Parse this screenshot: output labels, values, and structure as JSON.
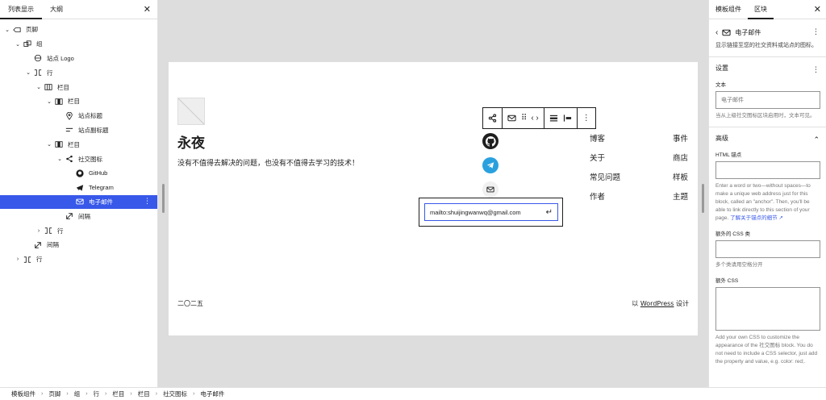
{
  "left_panel": {
    "tabs": [
      "列表显示",
      "大纲"
    ],
    "close_glyph": "✕",
    "tree": [
      {
        "label": "页脚",
        "depth": 0,
        "chev": "⌄",
        "icon": "template-part-icon"
      },
      {
        "label": "组",
        "depth": 1,
        "chev": "⌄",
        "icon": "group-icon"
      },
      {
        "label": "站点 Logo",
        "depth": 2,
        "chev": "",
        "icon": "site-logo-icon"
      },
      {
        "label": "行",
        "depth": 2,
        "chev": "⌄",
        "icon": "row-icon"
      },
      {
        "label": "栏目",
        "depth": 3,
        "chev": "⌄",
        "icon": "columns-icon"
      },
      {
        "label": "栏目",
        "depth": 4,
        "chev": "⌄",
        "icon": "column-icon"
      },
      {
        "label": "站点标题",
        "depth": 5,
        "chev": "",
        "icon": "map-pin-icon"
      },
      {
        "label": "站点副标题",
        "depth": 5,
        "chev": "",
        "icon": "tagline-icon"
      },
      {
        "label": "栏目",
        "depth": 4,
        "chev": "⌄",
        "icon": "column-icon"
      },
      {
        "label": "社交图标",
        "depth": 5,
        "chev": "⌄",
        "icon": "share-icon"
      },
      {
        "label": "GitHub",
        "depth": 6,
        "chev": "",
        "icon": "github-icon"
      },
      {
        "label": "Telegram",
        "depth": 6,
        "chev": "",
        "icon": "telegram-icon"
      },
      {
        "label": "电子邮件",
        "depth": 6,
        "chev": "",
        "icon": "mail-icon",
        "selected": true
      },
      {
        "label": "间隔",
        "depth": 5,
        "chev": "",
        "icon": "spacer-icon"
      },
      {
        "label": "行",
        "depth": 3,
        "chev": "›",
        "icon": "row-icon"
      },
      {
        "label": "间隔",
        "depth": 2,
        "chev": "",
        "icon": "spacer-icon"
      },
      {
        "label": "行",
        "depth": 1,
        "chev": "›",
        "icon": "row-icon"
      }
    ]
  },
  "canvas": {
    "site_title": "永夜",
    "site_tagline": "没有不值得去解决的问题，也没有不值得去学习的技术！",
    "url_value": "mailto:shuijingwanwq@gmail.com",
    "nav_col1": [
      "博客",
      "关于",
      "常见问题",
      "作者"
    ],
    "nav_col2": [
      "事件",
      "商店",
      "样板",
      "主题"
    ],
    "footer_left": "二〇二五",
    "footer_right_prefix": "以 ",
    "footer_right_link": "WordPress",
    "footer_right_suffix": " 设计"
  },
  "right_panel": {
    "tabs": [
      "模板组件",
      "区块"
    ],
    "close_glyph": "✕",
    "block_name": "电子邮件",
    "block_desc": "显示链接至您的社交资料或站点的图标。",
    "settings_title": "设置",
    "text_label": "文本",
    "text_placeholder": "电子邮件",
    "text_help": "当从上级社交图标区块启用时，文本可见。",
    "advanced_title": "高级",
    "anchor_label": "HTML 锚点",
    "anchor_help": "Enter a word or two—without spaces—to make a unique web address just for this block, called an \"anchor\". Then, you'll be able to link directly to this section of your page.",
    "anchor_link": "了解关于锚点的细节 ↗",
    "css_class_label": "额外的 CSS 类",
    "css_class_help": "多个类请用空格分开",
    "css_label": "额外 CSS",
    "css_help": "Add your own CSS to customize the appearance of the 社交图标 block. You do not need to include a CSS selector, just add the property and value, e.g. color: red;."
  },
  "breadcrumb": [
    "模板组件",
    "页脚",
    "组",
    "行",
    "栏目",
    "栏目",
    "社交图标",
    "电子邮件"
  ],
  "colors": {
    "accent": "#3858e9",
    "telegram": "#2aa1de",
    "canvas_bg": "#dddddd"
  }
}
